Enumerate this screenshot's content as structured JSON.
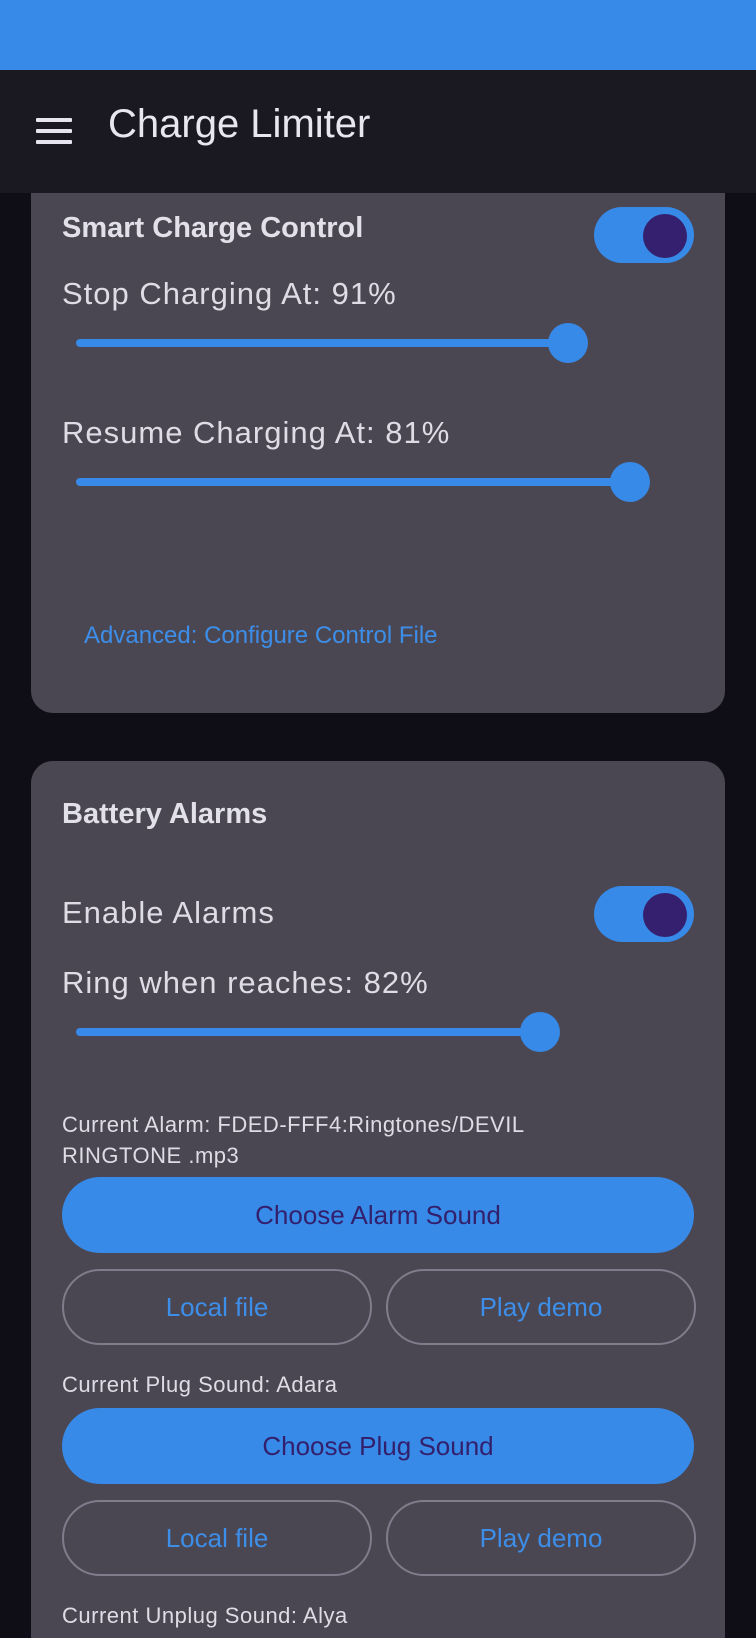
{
  "app_bar": {
    "title": "Charge Limiter",
    "menu_icon": "menu-icon"
  },
  "colors": {
    "status_bar": "#378ae8",
    "app_bar": "#1a1922",
    "background": "#0f0e17",
    "card": "#4a4753",
    "accent": "#378ae8",
    "accent_dark": "#35206f"
  },
  "smart_charge": {
    "title": "Smart Charge Control",
    "enabled": true,
    "stop_label": "Stop Charging At: 91%",
    "stop_value_fraction": 0.8,
    "resume_label": "Resume Charging At: 81%",
    "resume_value_fraction": 0.92,
    "advanced_link": "Advanced: Configure Control File"
  },
  "battery_alarms": {
    "title": "Battery Alarms",
    "enable_label": "Enable Alarms",
    "enabled": true,
    "ring_label": "Ring when reaches: 82%",
    "ring_value_fraction": 0.76,
    "current_alarm": "Current Alarm: FDED-FFF4:Ringtones/DEVIL RINGTONE .mp3",
    "choose_alarm_button": "Choose Alarm Sound",
    "alarm_local_file_button": "Local file",
    "alarm_play_demo_button": "Play demo",
    "current_plug": "Current Plug Sound: Adara",
    "choose_plug_button": "Choose Plug Sound",
    "plug_local_file_button": "Local file",
    "plug_play_demo_button": "Play demo",
    "current_unplug": "Current Unplug Sound: Alya"
  }
}
